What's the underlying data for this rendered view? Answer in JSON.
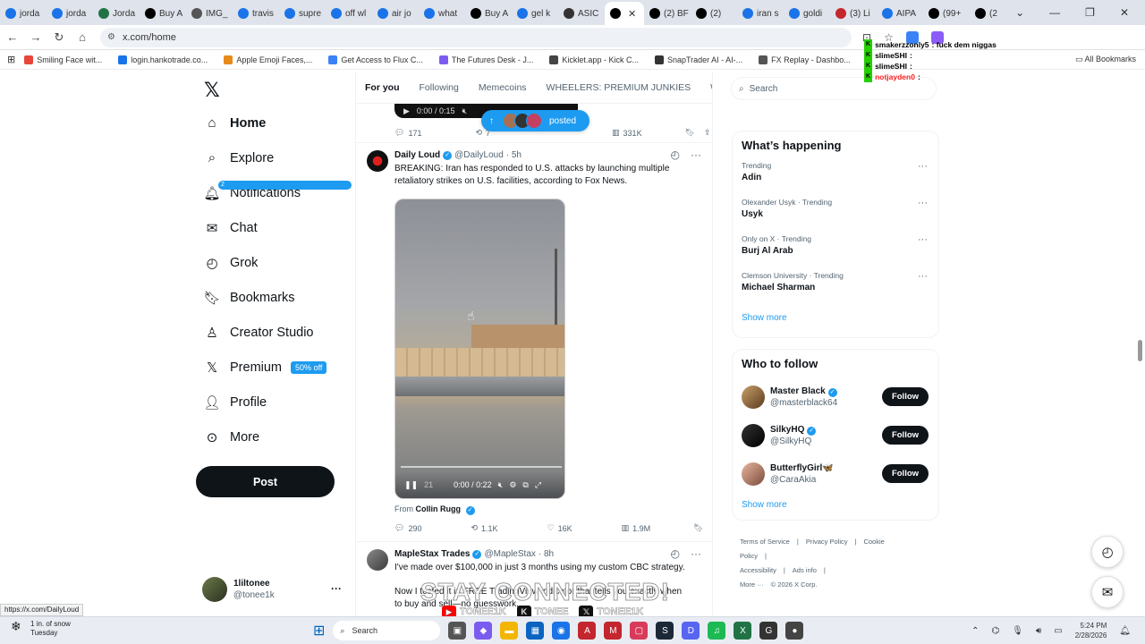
{
  "browser": {
    "tabs": [
      "jorda",
      "jorda",
      "Jorda",
      "Buy A",
      "IMG_",
      "travis",
      "supre",
      "off wl",
      "air jo",
      "what",
      "Buy A",
      "gel k",
      "ASIC",
      "",
      "(2) BF",
      "(2)",
      "iran s",
      "goldi",
      "(3) Li",
      "AIPA",
      "(99+",
      "(2) ki"
    ],
    "active_tab_index": 13,
    "url": "x.com/home",
    "bookmarks": [
      "Smiling Face wit...",
      "login.hankotrade.co...",
      "Apple Emoji Faces,...",
      "Get Access to Flux C...",
      "The Futures Desk - J...",
      "Kicklet.app - Kick C...",
      "SnapTrader AI - AI-...",
      "FX Replay - Dashbo..."
    ],
    "all_bookmarks": "All Bookmarks",
    "status_url": "https://x.com/DailyLoud"
  },
  "nav": {
    "items": [
      {
        "label": "Home",
        "icon": "home-icon",
        "glyph": "⌂"
      },
      {
        "label": "Explore",
        "icon": "search-icon",
        "glyph": "⌕"
      },
      {
        "label": "Notifications",
        "icon": "bell-icon",
        "glyph": "🔔︎"
      },
      {
        "label": "Chat",
        "icon": "mail-icon",
        "glyph": "✉"
      },
      {
        "label": "Grok",
        "icon": "grok-icon",
        "glyph": "◴"
      },
      {
        "label": "Bookmarks",
        "icon": "bookmark-icon",
        "glyph": "🔖︎"
      },
      {
        "label": "Creator Studio",
        "icon": "creator-icon",
        "glyph": "♙"
      },
      {
        "label": "Premium",
        "icon": "x-logo-icon",
        "glyph": "𝕏"
      },
      {
        "label": "Profile",
        "icon": "person-icon",
        "glyph": "👤︎"
      },
      {
        "label": "More",
        "icon": "more-icon",
        "glyph": "⊙"
      }
    ],
    "notification_badge": "2",
    "premium_badge": "50% off",
    "post_label": "Post"
  },
  "me": {
    "name": "1liltonee",
    "handle": "@tonee1k"
  },
  "timeline": {
    "tabs": [
      "For you",
      "Following",
      "Memecoins",
      "WHEELERS: PREMIUM JUNKIES",
      "WHA"
    ],
    "prev_tweet": {
      "player_time": "0:00 / 0:15",
      "replies": "171",
      "retweets": "7",
      "views": "331K"
    },
    "posted_pill": "posted",
    "tweet1": {
      "name": "Daily Loud",
      "handle": "@DailyLoud",
      "time": "· 5h",
      "text": "BREAKING: Iran has responded to U.S. attacks by launching multiple retaliatory strikes on U.S. facilities, according to Fox News.",
      "video_time": "0:00 / 0:22",
      "video_elapsed": "21",
      "from_prefix": "From",
      "from_name": "Collin Rugg",
      "replies": "290",
      "retweets": "1.1K",
      "likes": "16K",
      "views": "1.9M"
    },
    "tweet2": {
      "name": "MapleStax Trades",
      "handle": "@MapleStax",
      "time": "· 8h",
      "text1": "I've made over $100,000 in just 3 months using my custom CBC strategy.",
      "text2": "Now I tested it in FREE TradingView indicator that tells you exactly when to buy and sell—no guesswork."
    }
  },
  "sidebar": {
    "search_placeholder": "Search",
    "happening_title": "What’s happening",
    "trends": [
      {
        "context": "Trending",
        "title": "Adin"
      },
      {
        "context": "Olexander Usyk · Trending",
        "title": "Usyk"
      },
      {
        "context": "Only on X · Trending",
        "title": "Burj Al Arab"
      },
      {
        "context": "Clemson University · Trending",
        "title": "Michael Sharman"
      }
    ],
    "show_more": "Show more",
    "follow_title": "Who to follow",
    "follow": [
      {
        "name": "Master Black",
        "handle": "@masterblack64",
        "verified": true
      },
      {
        "name": "SilkyHQ",
        "handle": "@SilkyHQ",
        "verified": true
      },
      {
        "name": "ButterflyGirl🦋",
        "handle": "@CaraAkia",
        "verified": false
      }
    ],
    "follow_label": "Follow",
    "footer": [
      "Terms of Service",
      "|",
      "Privacy Policy",
      "|",
      "Cookie Policy",
      "|",
      "Accessibility",
      "|",
      "Ads info",
      "|",
      "More ···",
      "© 2026 X Corp."
    ]
  },
  "overlay": {
    "chat": [
      {
        "user": "smakerzzonly5",
        "msg": ": fuck dem niggas"
      },
      {
        "user": "slimeSHI",
        "msg": ":"
      },
      {
        "user": "slimeSHI",
        "msg": ":"
      },
      {
        "user": "notjayden0",
        "msg": ":"
      }
    ],
    "stay_text": "STAY CONNECTED!",
    "social": [
      "TONEE1K",
      "TONEE",
      "TONEE1K"
    ]
  },
  "taskbar": {
    "weather_temp": "1 in. of snow",
    "weather_day": "Tuesday",
    "search_placeholder": "Search",
    "time": "5:24 PM",
    "date": "2/28/2026"
  }
}
